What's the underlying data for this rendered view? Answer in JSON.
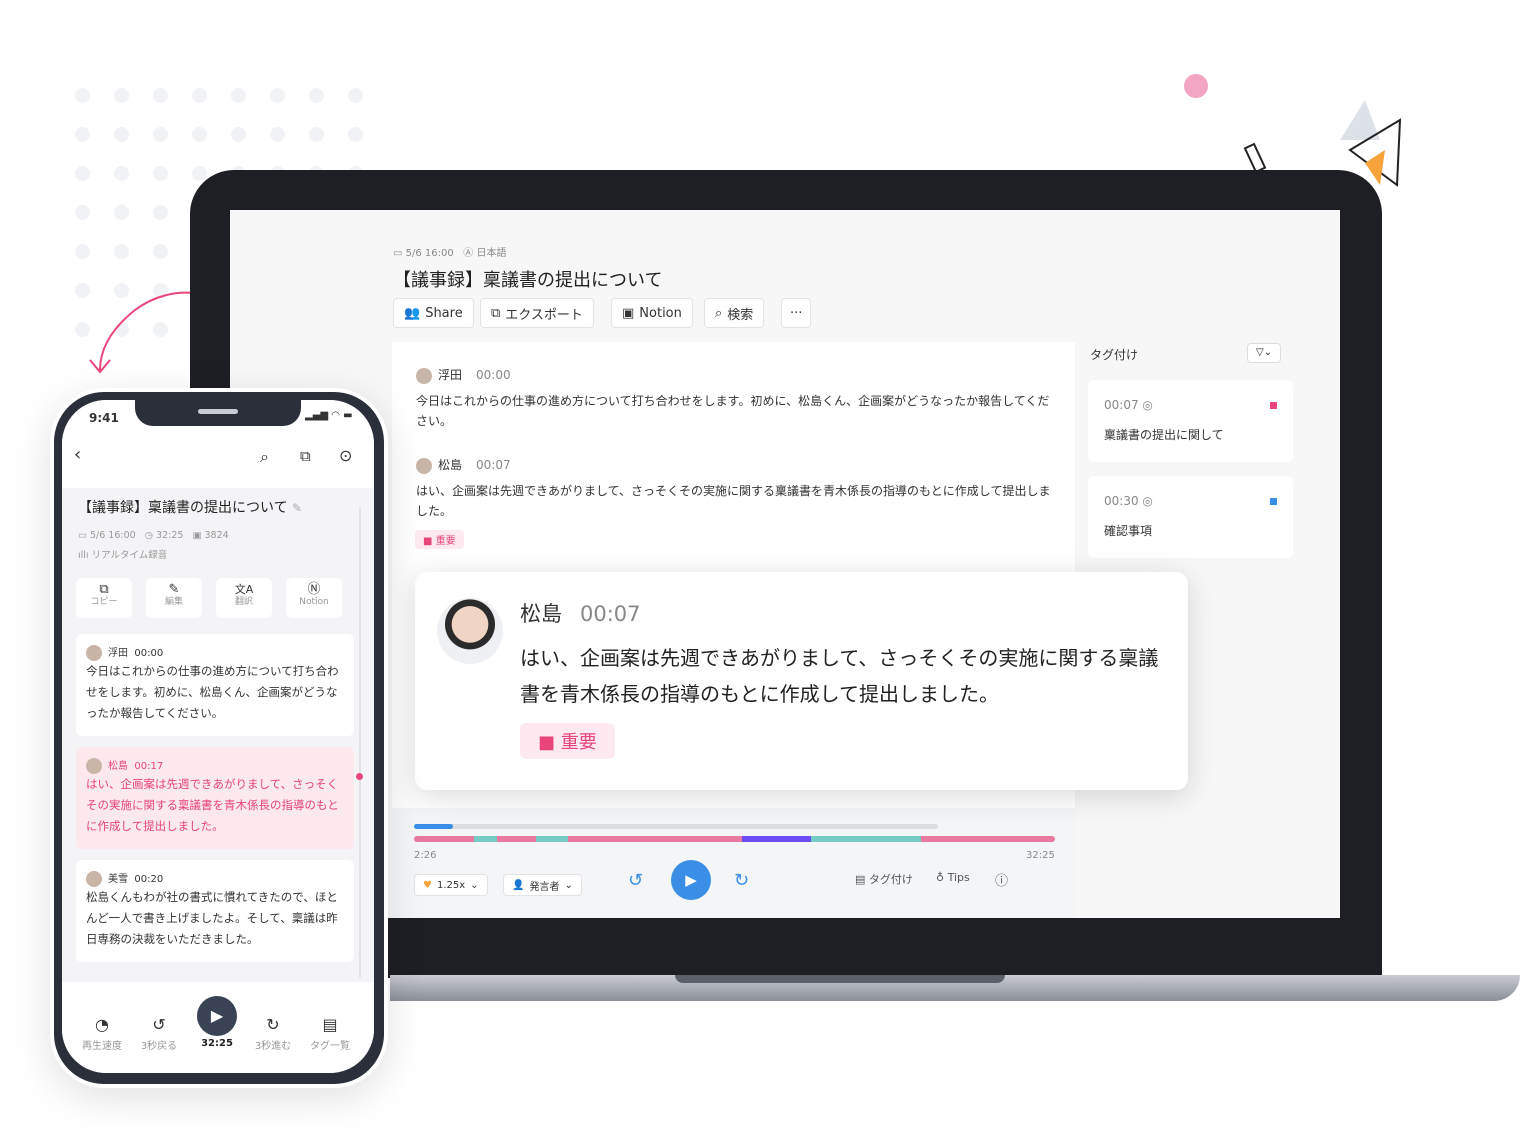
{
  "laptop": {
    "meta_date": "5/6 16:00",
    "meta_lang": "日本語",
    "title": "【議事録】稟議書の提出について",
    "toolbar": {
      "share": "Share",
      "export": "エクスポート",
      "notion": "Notion",
      "search": "検索",
      "more": "···"
    },
    "entries": [
      {
        "speaker": "浮田",
        "time": "00:00",
        "text": "今日はこれからの仕事の進め方について打ち合わせをします。初めに、松島くん、企画案がどうなったか報告してください。"
      },
      {
        "speaker": "松島",
        "time": "00:07",
        "text": "はい、企画案は先週できあがりまして、さっそくその実施に関する稟議書を青木係長の指導のもとに作成して提出しました。",
        "tag": "重要"
      }
    ],
    "tags_panel": {
      "title": "タグ付け",
      "items": [
        {
          "time": "00:07",
          "label": "稟議書の提出に関して",
          "color": "#e8457a"
        },
        {
          "time": "00:30",
          "label": "確認事項",
          "color": "#3a8ee6"
        }
      ]
    },
    "player": {
      "current": "2:26",
      "total": "32:25",
      "speed": "1.25x",
      "speaker_filter": "発言者",
      "tagging": "タグ付け",
      "tips": "Tips",
      "progress_percent": 7.5
    }
  },
  "popup": {
    "speaker": "松島",
    "time": "00:07",
    "text": "はい、企画案は先週できあがりまして、さっそくその実施に関する稟議書を青木係長の指導のもとに作成して提出しました。",
    "tag": "重要"
  },
  "phone": {
    "status_time": "9:41",
    "title": "【議事録】稟議書の提出について",
    "date": "5/6 16:00",
    "duration": "32:25",
    "chars": "3824",
    "mode": "リアルタイム録音",
    "actions": [
      "コピー",
      "編集",
      "翻訳",
      "Notion"
    ],
    "entries": [
      {
        "speaker": "浮田",
        "time": "00:00",
        "text": "今日はこれからの仕事の進め方について打ち合わせをします。初めに、松島くん、企画案がどうなったか報告してください。"
      },
      {
        "speaker": "松島",
        "time": "00:17",
        "text": "はい、企画案は先週できあがりまして、さっそくその実施に関する稟議書を青木係長の指導のもとに作成して提出しました。"
      },
      {
        "speaker": "美雪",
        "time": "00:20",
        "text": "松島くんもわが社の書式に慣れてきたので、ほとんど一人で書き上げましたよ。そして、稟議は昨日専務の決裁をいただきました。"
      }
    ],
    "controls": [
      "再生速度",
      "3秒戻る",
      "32:25",
      "3秒進む",
      "タグ一覧"
    ]
  },
  "colors": {
    "accent": "#3a8ee6",
    "pink": "#e8457a",
    "teal": "#76cbc4",
    "purple": "#6b4cf6"
  }
}
